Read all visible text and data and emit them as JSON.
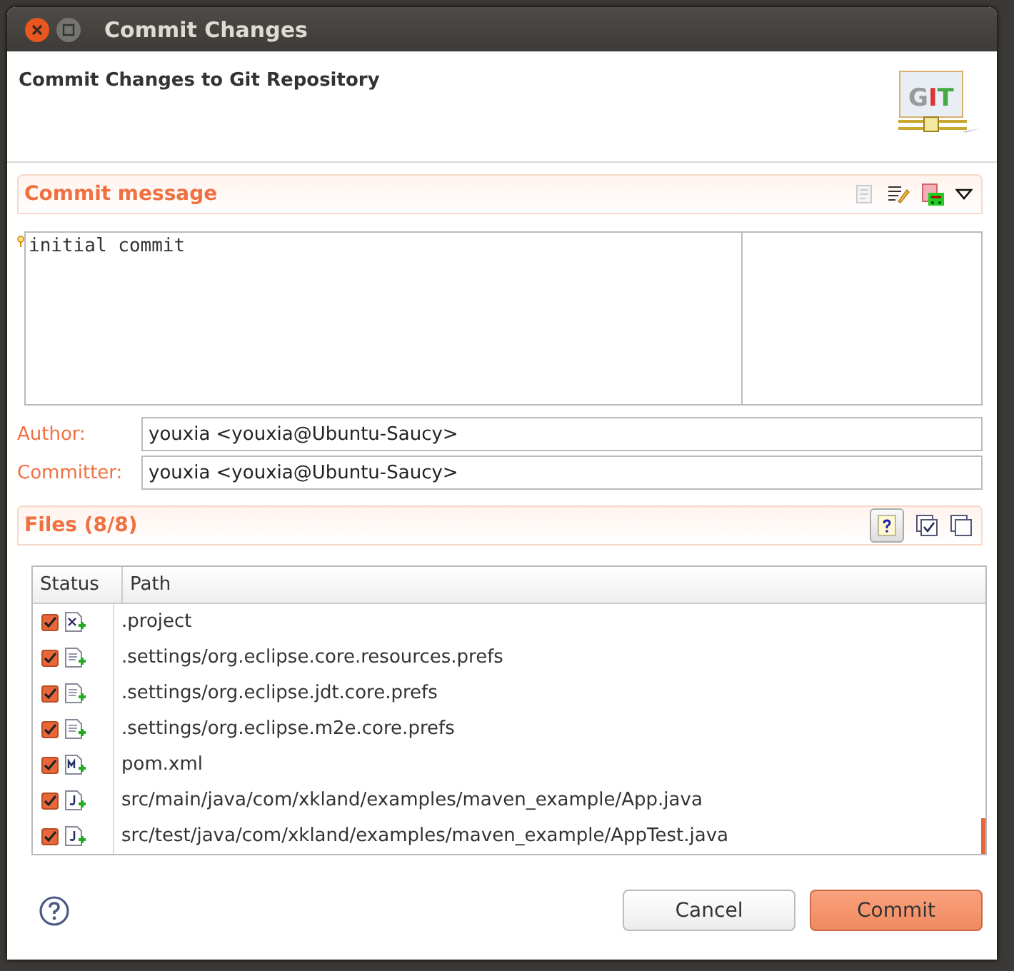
{
  "window": {
    "title": "Commit Changes"
  },
  "header": {
    "title": "Commit Changes to Git Repository",
    "logo": "GIT"
  },
  "commit_message": {
    "title": "Commit message",
    "value": "initial commit"
  },
  "author": {
    "label": "Author:",
    "value": "youxia <youxia@Ubuntu-Saucy>"
  },
  "committer": {
    "label": "Committer:",
    "value": "youxia <youxia@Ubuntu-Saucy>"
  },
  "files": {
    "title": "Files (8/8)",
    "show_untracked": {
      "selected": true
    },
    "columns": [
      "Status",
      "Path"
    ],
    "rows": [
      {
        "path": ".project",
        "checked": true,
        "kind": "xml"
      },
      {
        "path": ".settings/org.eclipse.core.resources.prefs",
        "checked": true,
        "kind": "text"
      },
      {
        "path": ".settings/org.eclipse.jdt.core.prefs",
        "checked": true,
        "kind": "text"
      },
      {
        "path": ".settings/org.eclipse.m2e.core.prefs",
        "checked": true,
        "kind": "text"
      },
      {
        "path": "pom.xml",
        "checked": true,
        "kind": "maven"
      },
      {
        "path": "src/main/java/com/xkland/examples/maven_example/App.java",
        "checked": true,
        "kind": "java"
      },
      {
        "path": "src/test/java/com/xkland/examples/maven_example/AppTest.java",
        "checked": true,
        "kind": "java"
      }
    ]
  },
  "buttons": [
    {
      "label": "Cancel",
      "kind": "secondary"
    },
    {
      "label": "Commit",
      "kind": "primary"
    }
  ]
}
